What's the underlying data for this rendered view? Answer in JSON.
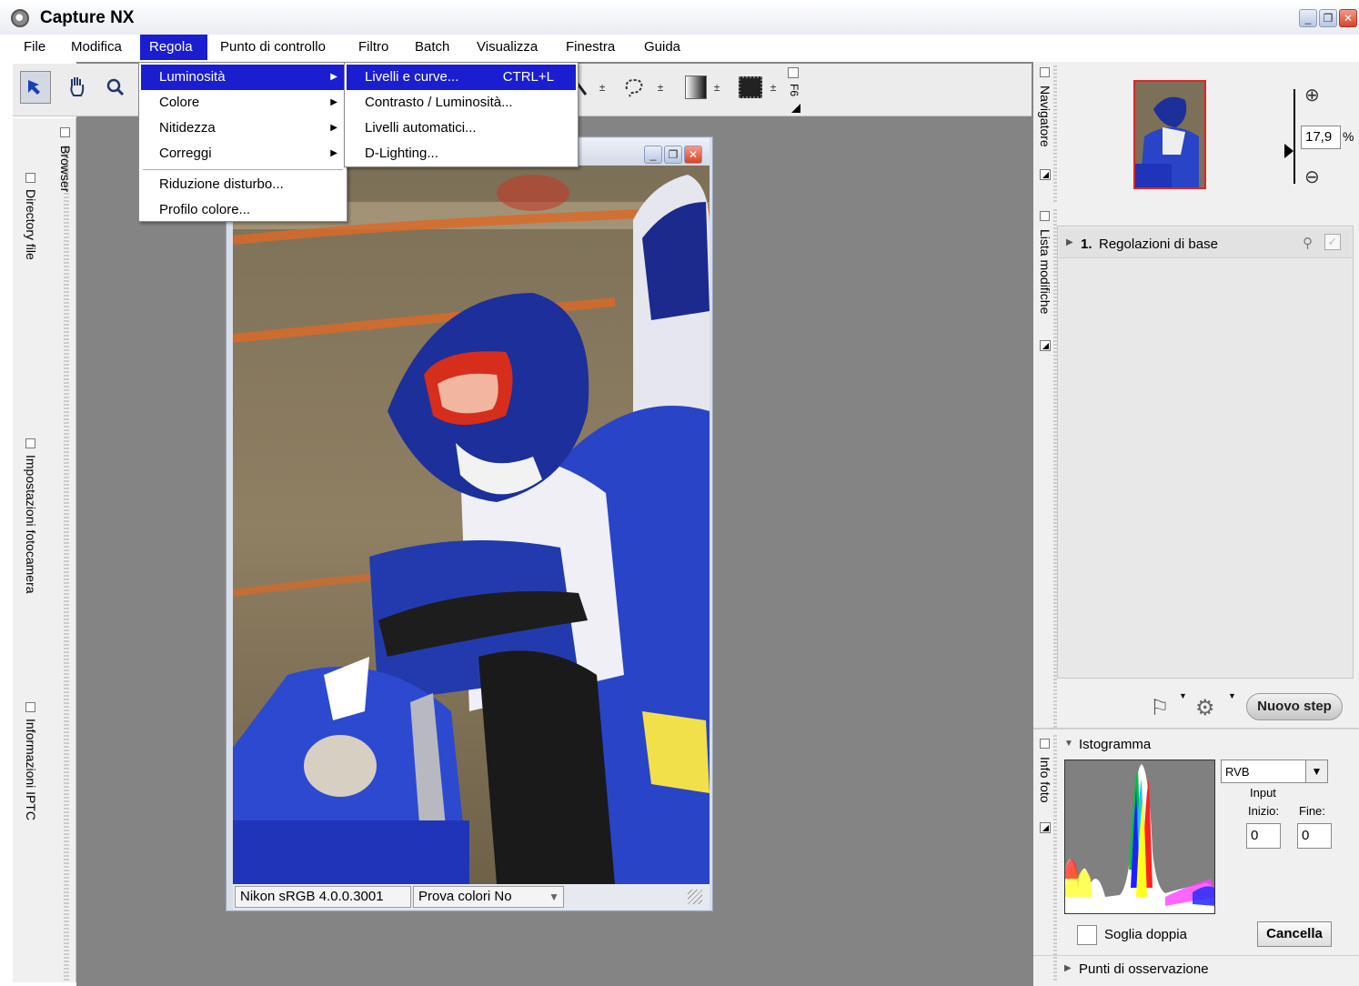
{
  "app": {
    "title": "Capture NX"
  },
  "menubar": {
    "items": [
      "File",
      "Modifica",
      "Regola",
      "Punto di controllo",
      "Filtro",
      "Batch",
      "Visualizza",
      "Finestra",
      "Guida"
    ]
  },
  "regola_menu": {
    "items": [
      "Luminosità",
      "Colore",
      "Nitidezza",
      "Correggi",
      "Riduzione disturbo...",
      "Profilo colore..."
    ]
  },
  "luminosita_submenu": {
    "items": [
      "Livelli e curve...",
      "Contrasto / Luminosità...",
      "Livelli automatici...",
      "D-Lighting..."
    ],
    "shortcut": "CTRL+L"
  },
  "toolbar": {
    "f6_label": "F6"
  },
  "left_dock": {
    "browser": "Browser",
    "tabs": [
      "Directory file",
      "Impostazioni fotocamera",
      "Informazioni IPTC"
    ]
  },
  "image_window": {
    "profile": "Nikon sRGB 4.0.0.3001",
    "proof": "Prova colori No"
  },
  "navigator": {
    "tab": "Navigatore",
    "zoom": "17,9",
    "zoom_unit": "%"
  },
  "edit_list": {
    "tab": "Lista modifiche",
    "step_number": "1.",
    "step_name": "Regolazioni di base",
    "new_step": "Nuovo step"
  },
  "photo_info": {
    "tab": "Info foto",
    "histogram_label": "Istogramma",
    "channel": "RVB",
    "input_label": "Input",
    "start_label": "Inizio:",
    "end_label": "Fine:",
    "start_value": "0",
    "end_value": "0",
    "double_threshold": "Soglia doppia",
    "cancel": "Cancella",
    "watch_points": "Punti di osservazione"
  }
}
